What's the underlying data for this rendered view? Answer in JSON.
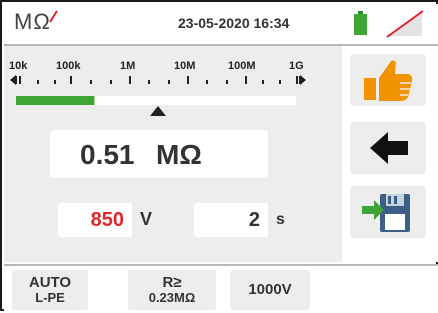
{
  "status_bar": {
    "mode": "MΩ",
    "datetime": "23-05-2020 16:34",
    "battery_icon": "battery-full-icon",
    "signal_icon": "signal-off-icon",
    "battery_color": "#3fa535"
  },
  "scale": {
    "labels": [
      "10k",
      "100k",
      "1M",
      "10M",
      "100M",
      "1G"
    ],
    "bar_fill": 0.28,
    "bar_color": "#3fa535"
  },
  "measurement": {
    "value": "0.51",
    "unit": "MΩ"
  },
  "test_voltage": {
    "value": "850",
    "unit": "V",
    "color": "#e0262b"
  },
  "test_time": {
    "value": "2",
    "unit": "s"
  },
  "side_buttons": {
    "result_icon": "thumbs-up-icon",
    "back_icon": "arrow-left-icon",
    "save_icon": "save-to-memory-icon",
    "accent": "#f29400"
  },
  "soft_keys": {
    "mode_line1": "AUTO",
    "mode_line2": "L-PE",
    "limit_line1": "R≥",
    "limit_line2": "0.23MΩ",
    "voltage": "1000V"
  }
}
